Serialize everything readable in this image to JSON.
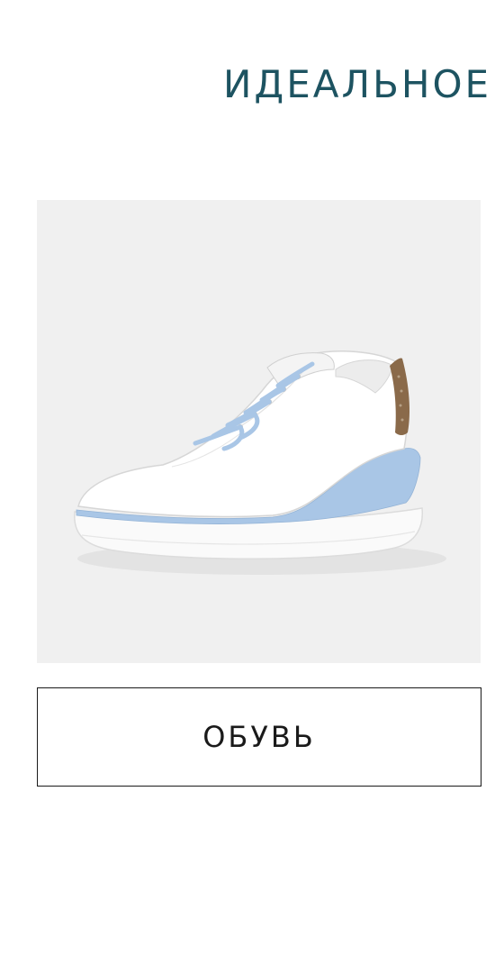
{
  "promo": {
    "headline": "ИДЕАЛЬНОЕ",
    "headline_color": "#1d5361",
    "image": {
      "subject": "sneaker-image",
      "background_color": "#f0f0f0",
      "accent_color": "#a9c6e6",
      "heel_tab_color": "#8a6a4a"
    },
    "cta_label": "ОБУВЬ"
  }
}
